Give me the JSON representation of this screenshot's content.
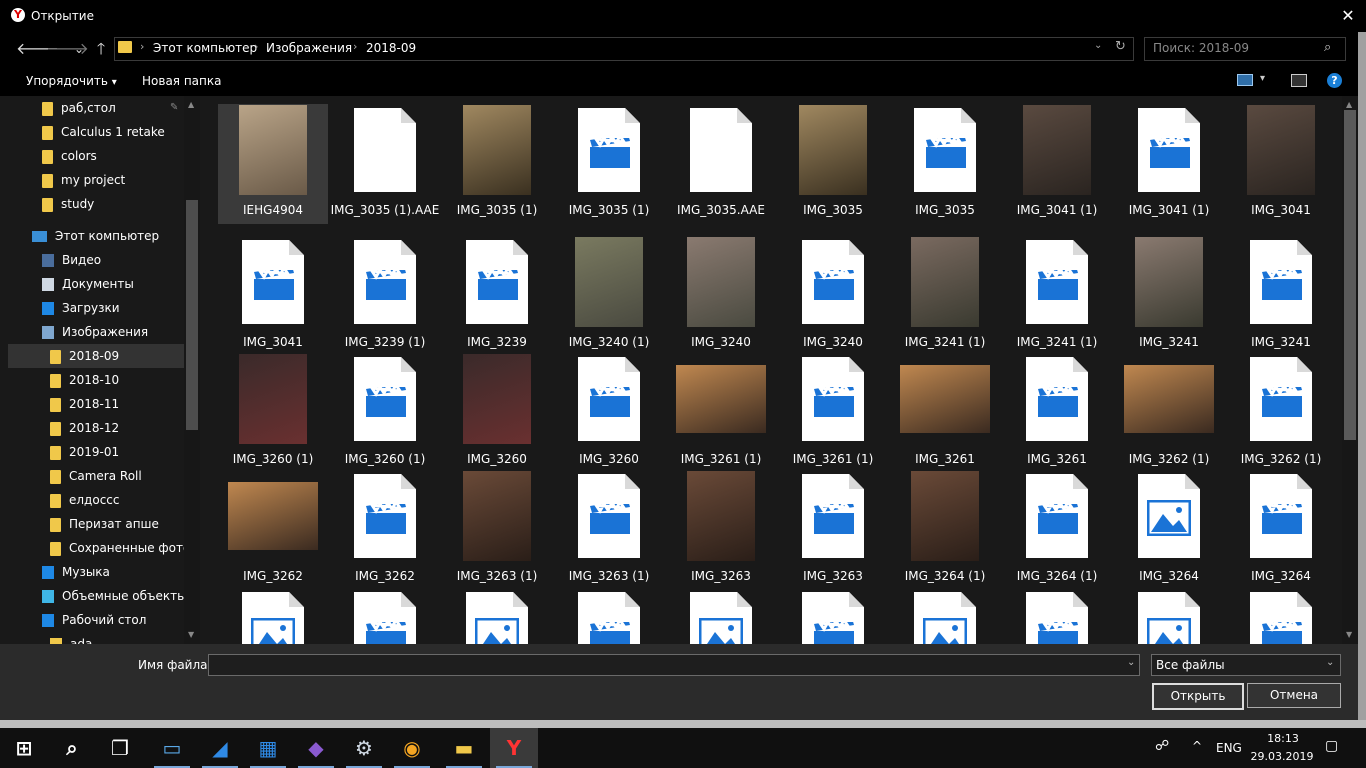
{
  "window": {
    "title": "Открытие",
    "close": "✕"
  },
  "nav": {
    "back": "🡐",
    "forward": "🡒",
    "recent": "⌄",
    "up": "🡑"
  },
  "address": {
    "crumbs": [
      "Этот компьютер",
      "Изображения",
      "2018-09"
    ],
    "sep": "›",
    "dd": "⌄",
    "refresh": "↻"
  },
  "search": {
    "placeholder": "Поиск: 2018-09",
    "icon": "⌕"
  },
  "toolbar": {
    "sort": "Упорядочить",
    "sort_dd": "▾",
    "new_folder": "Новая папка",
    "view_dd": "▾",
    "help": "?"
  },
  "sidebar": {
    "pinned": [
      "раб,стол",
      "Calculus 1 retake",
      "colors",
      "my project",
      "study"
    ],
    "this_pc": "Этот компьютер",
    "pc_items": [
      {
        "label": "Видео",
        "icon": "video-icon",
        "color": "#4a6d9c"
      },
      {
        "label": "Документы",
        "icon": "documents-icon",
        "color": "#cfd8e3"
      },
      {
        "label": "Загрузки",
        "icon": "downloads-icon",
        "color": "#1e88e5"
      },
      {
        "label": "Изображения",
        "icon": "pictures-icon",
        "color": "#7fa7cf"
      }
    ],
    "subfolders": [
      "2018-09",
      "2018-10",
      "2018-11",
      "2018-12",
      "2019-01",
      "Camera Roll",
      "елдосcс",
      "Перизат апше",
      "Сохраненные фотогр"
    ],
    "tail": [
      {
        "label": "Музыка",
        "icon": "music-icon",
        "color": "#1e88e5"
      },
      {
        "label": "Объемные объекты",
        "icon": "3d-objects-icon",
        "color": "#3fb6e6"
      },
      {
        "label": "Рабочий стол",
        "icon": "desktop-icon",
        "color": "#1e88e5"
      },
      {
        "label": "ada",
        "icon": "folder-icon",
        "color": "#f0c84a"
      }
    ],
    "selected": "2018-09"
  },
  "files": [
    [
      {
        "name": "IEHG4904",
        "kind": "photo",
        "c1": "#b9a488",
        "c2": "#6a5a48"
      },
      {
        "name": "IMG_3035 (1).AAE",
        "kind": "doc"
      },
      {
        "name": "IMG_3035 (1)",
        "kind": "photo",
        "c1": "#a08860",
        "c2": "#3a3020"
      },
      {
        "name": "IMG_3035 (1)",
        "kind": "video"
      },
      {
        "name": "IMG_3035.AAE",
        "kind": "doc"
      },
      {
        "name": "IMG_3035",
        "kind": "photo",
        "c1": "#a08860",
        "c2": "#3a3020"
      },
      {
        "name": "IMG_3035",
        "kind": "video"
      },
      {
        "name": "IMG_3041 (1)",
        "kind": "photo",
        "c1": "#5a4a40",
        "c2": "#2a2420"
      },
      {
        "name": "IMG_3041 (1)",
        "kind": "video"
      },
      {
        "name": "IMG_3041",
        "kind": "photo",
        "c1": "#5a4a40",
        "c2": "#2a2420"
      }
    ],
    [
      {
        "name": "IMG_3041",
        "kind": "video"
      },
      {
        "name": "IMG_3239 (1)",
        "kind": "video"
      },
      {
        "name": "IMG_3239",
        "kind": "video"
      },
      {
        "name": "IMG_3240 (1)",
        "kind": "photo",
        "c1": "#7a7a60",
        "c2": "#4a4a40"
      },
      {
        "name": "IMG_3240",
        "kind": "photo",
        "c1": "#8a7a70",
        "c2": "#4a4a40"
      },
      {
        "name": "IMG_3240",
        "kind": "video"
      },
      {
        "name": "IMG_3241 (1)",
        "kind": "photo",
        "c1": "#7a6a60",
        "c2": "#3a3a30"
      },
      {
        "name": "IMG_3241 (1)",
        "kind": "video"
      },
      {
        "name": "IMG_3241",
        "kind": "photo",
        "c1": "#8a7a70",
        "c2": "#3a3a30"
      },
      {
        "name": "IMG_3241",
        "kind": "video"
      }
    ],
    [
      {
        "name": "IMG_3260 (1)",
        "kind": "photo",
        "c1": "#3a2a2a",
        "c2": "#6a3030"
      },
      {
        "name": "IMG_3260 (1)",
        "kind": "video"
      },
      {
        "name": "IMG_3260",
        "kind": "photo",
        "c1": "#3a2a2a",
        "c2": "#6a3030"
      },
      {
        "name": "IMG_3260",
        "kind": "video"
      },
      {
        "name": "IMG_3261 (1)",
        "kind": "wide",
        "c1": "#c08850",
        "c2": "#3a2a20"
      },
      {
        "name": "IMG_3261 (1)",
        "kind": "video"
      },
      {
        "name": "IMG_3261",
        "kind": "wide",
        "c1": "#c08850",
        "c2": "#3a2a20"
      },
      {
        "name": "IMG_3261",
        "kind": "video"
      },
      {
        "name": "IMG_3262 (1)",
        "kind": "wide",
        "c1": "#c08850",
        "c2": "#3a2a20"
      },
      {
        "name": "IMG_3262 (1)",
        "kind": "video"
      }
    ],
    [
      {
        "name": "IMG_3262",
        "kind": "wide",
        "c1": "#c08850",
        "c2": "#3a2a20"
      },
      {
        "name": "IMG_3262",
        "kind": "video"
      },
      {
        "name": "IMG_3263 (1)",
        "kind": "photo",
        "c1": "#6a4a38",
        "c2": "#2a1e18"
      },
      {
        "name": "IMG_3263 (1)",
        "kind": "video"
      },
      {
        "name": "IMG_3263",
        "kind": "photo",
        "c1": "#6a4a38",
        "c2": "#2a1e18"
      },
      {
        "name": "IMG_3263",
        "kind": "video"
      },
      {
        "name": "IMG_3264 (1)",
        "kind": "photo",
        "c1": "#6a4a38",
        "c2": "#2a1e18"
      },
      {
        "name": "IMG_3264 (1)",
        "kind": "video"
      },
      {
        "name": "IMG_3264",
        "kind": "image"
      },
      {
        "name": "IMG_3264",
        "kind": "video"
      }
    ],
    [
      {
        "name": "",
        "kind": "image"
      },
      {
        "name": "",
        "kind": "video"
      },
      {
        "name": "",
        "kind": "image"
      },
      {
        "name": "",
        "kind": "video"
      },
      {
        "name": "",
        "kind": "image"
      },
      {
        "name": "",
        "kind": "video"
      },
      {
        "name": "",
        "kind": "image"
      },
      {
        "name": "",
        "kind": "video"
      },
      {
        "name": "",
        "kind": "image"
      },
      {
        "name": "",
        "kind": "video"
      }
    ]
  ],
  "selected_file": "IEHG4904",
  "bottom": {
    "filename_label": "Имя файла:",
    "filename_value": "",
    "filter": "Все файлы",
    "dd": "⌄",
    "open": "Открыть",
    "cancel": "Отмена"
  },
  "taskbar": {
    "apps": [
      {
        "name": "start-icon",
        "glyph": "⊞",
        "color": "#ffffff"
      },
      {
        "name": "search-icon",
        "glyph": "⌕",
        "color": "#ffffff"
      },
      {
        "name": "task-view-icon",
        "glyph": "❐",
        "color": "#ffffff"
      },
      {
        "name": "this-pc-icon",
        "glyph": "▭",
        "color": "#5aa8e6"
      },
      {
        "name": "vscode-icon",
        "glyph": "◢",
        "color": "#2f8ae6"
      },
      {
        "name": "store-icon",
        "glyph": "▦",
        "color": "#2f8ae6"
      },
      {
        "name": "visual-studio-icon",
        "glyph": "◆",
        "color": "#8a5ad0"
      },
      {
        "name": "steam-icon",
        "glyph": "⚙",
        "color": "#cfd8e3"
      },
      {
        "name": "ucbrowser-icon",
        "glyph": "◉",
        "color": "#f5a623"
      },
      {
        "name": "explorer-icon",
        "glyph": "▬",
        "color": "#f0c84a"
      },
      {
        "name": "yandex-browser-icon",
        "glyph": "Y",
        "color": "#ff3333"
      }
    ],
    "active": "yandex-browser-icon",
    "time": "18:13",
    "date": "29.03.2019",
    "lang": "ENG",
    "people": "☍",
    "up": "^",
    "notif": "▢"
  },
  "colors": {
    "accent": "#1a7fd6",
    "folder": "#f0c84a",
    "video_blue": "#1a73d6"
  }
}
